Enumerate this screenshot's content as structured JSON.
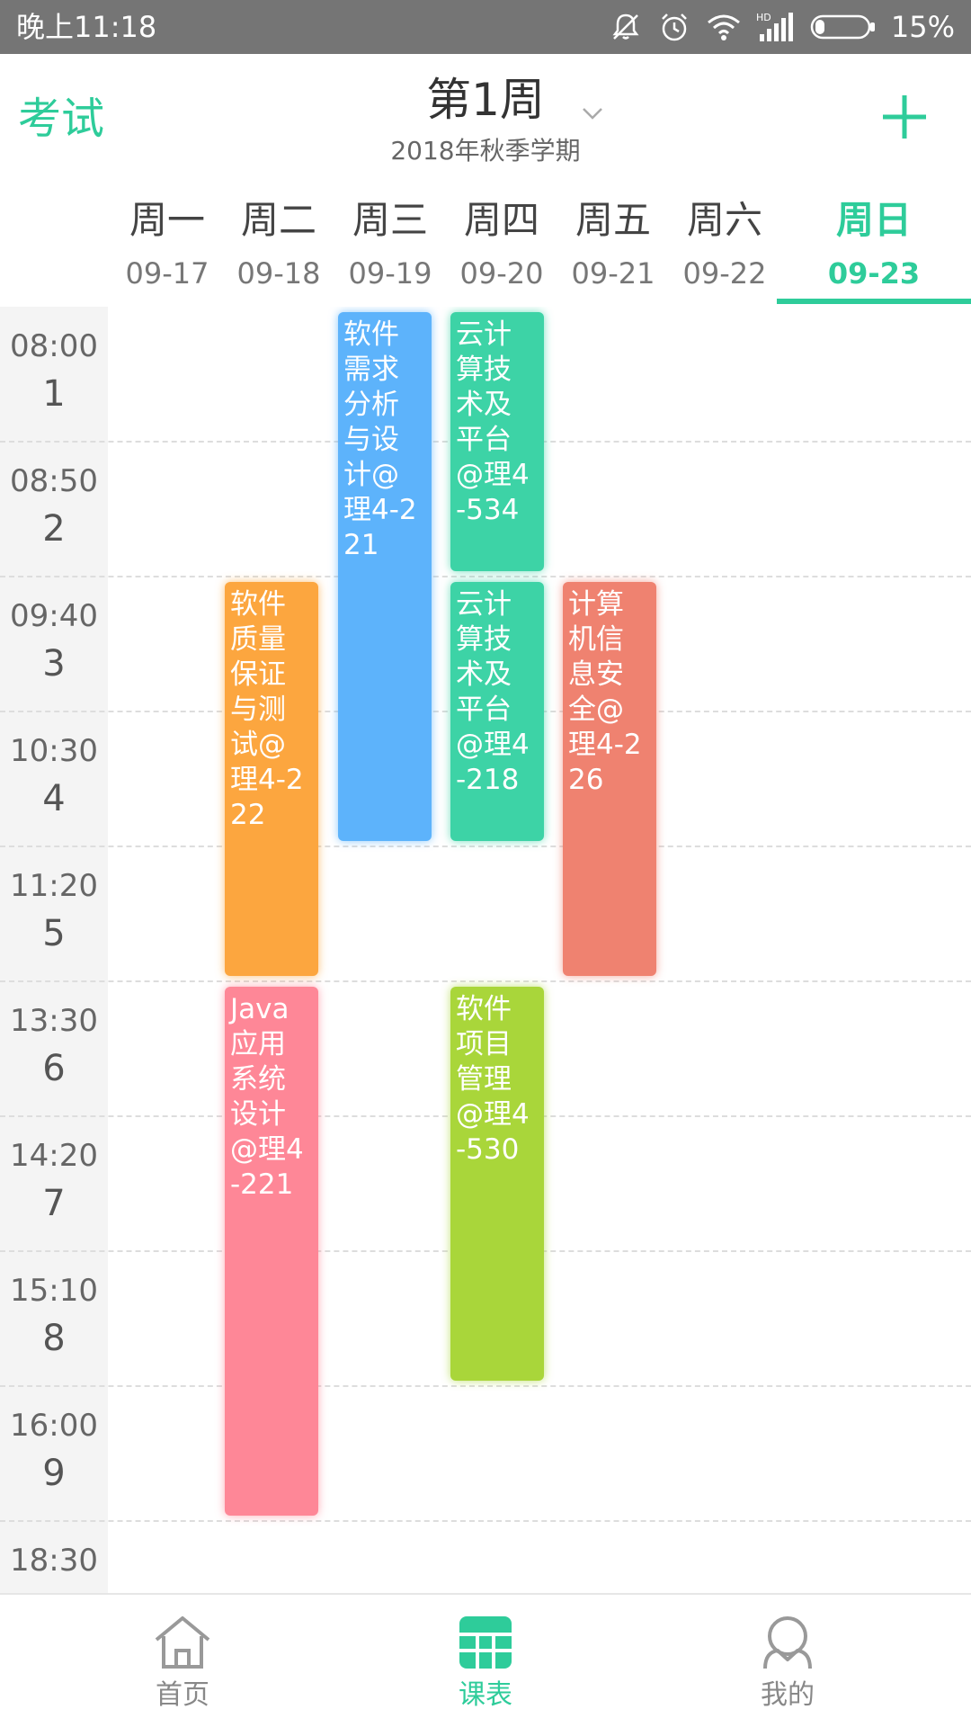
{
  "status_bar": {
    "time": "晚上11:18",
    "battery": "15%",
    "icons": [
      "mute-icon",
      "alarm-icon",
      "wifi-icon",
      "hd-signal-icon",
      "battery-icon"
    ]
  },
  "header": {
    "exam_label": "考试",
    "week_title": "第1周",
    "semester": "2018年秋季学期",
    "dropdown_icon": "chevron-down-icon",
    "add_icon": "plus-icon"
  },
  "days": [
    {
      "name": "周一",
      "date": "09-17"
    },
    {
      "name": "周二",
      "date": "09-18"
    },
    {
      "name": "周三",
      "date": "09-19"
    },
    {
      "name": "周四",
      "date": "09-20"
    },
    {
      "name": "周五",
      "date": "09-21"
    },
    {
      "name": "周六",
      "date": "09-22"
    },
    {
      "name": "周日",
      "date": "09-23",
      "active": true
    }
  ],
  "slots": [
    {
      "time": "08:00",
      "num": "1"
    },
    {
      "time": "08:50",
      "num": "2"
    },
    {
      "time": "09:40",
      "num": "3"
    },
    {
      "time": "10:30",
      "num": "4"
    },
    {
      "time": "11:20",
      "num": "5"
    },
    {
      "time": "13:30",
      "num": "6"
    },
    {
      "time": "14:20",
      "num": "7"
    },
    {
      "time": "15:10",
      "num": "8"
    },
    {
      "time": "16:00",
      "num": "9"
    },
    {
      "time": "18:30",
      "num": ""
    }
  ],
  "courses": [
    {
      "text": "软件需求分析与设计@理4-221",
      "day": 3,
      "start": 1,
      "end": 4,
      "color": "blue"
    },
    {
      "text": "云计算技术及平台@理4-534",
      "day": 4,
      "start": 1,
      "end": 2,
      "color": "teal"
    },
    {
      "text": "软件质量保证与测试@理4-222",
      "day": 2,
      "start": 3,
      "end": 5,
      "color": "orange"
    },
    {
      "text": "云计算技术及平台@理4-218",
      "day": 4,
      "start": 3,
      "end": 4,
      "color": "teal"
    },
    {
      "text": "计算机信息安全@理4-226",
      "day": 5,
      "start": 3,
      "end": 5,
      "color": "salmon"
    },
    {
      "text": "Java应用系统设计@理4-221",
      "day": 2,
      "start": 6,
      "end": 9,
      "color": "pink"
    },
    {
      "text": "软件项目管理@理4-530",
      "day": 4,
      "start": 6,
      "end": 8,
      "color": "green"
    }
  ],
  "colors": {
    "accent": "#2ecc9a",
    "blue": "#5db3fb",
    "teal": "#3dd3a6",
    "orange": "#fca63f",
    "salmon": "#ef8270",
    "pink": "#fe8797",
    "green": "#a9d63a"
  },
  "bottom_nav": [
    {
      "label": "首页",
      "icon": "home-icon",
      "active": false
    },
    {
      "label": "课表",
      "icon": "timetable-icon",
      "active": true
    },
    {
      "label": "我的",
      "icon": "profile-icon",
      "active": false
    }
  ]
}
